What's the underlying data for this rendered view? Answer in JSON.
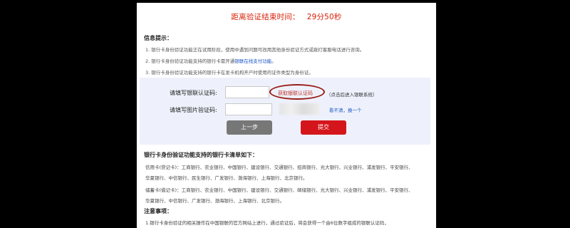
{
  "countdown": {
    "label": "距离验证结束时间：",
    "time": "29分50秒"
  },
  "info": {
    "title": "信息提示：",
    "lines": [
      "1. 银行卡身份验证功能正在试用阶段，使用中遇到问题可改用其他身份验证方式或拨打客服电话进行咨询。",
      "2. 银行卡身份验证功能支持的银行卡需开通",
      "3. 银行卡身份验证功能支持的银行卡在发卡机构开户时使用的证件类型为身份证。"
    ],
    "link": "银联在线支付功能",
    "line2_suffix": "。"
  },
  "form": {
    "sms_label": "请填写银联认证码:",
    "sms_link": "获取银联认证码",
    "sms_hint": "（点击后进入银联系统）",
    "captcha_label": "请填写图片验证码:",
    "refresh": "看不清，换一个",
    "prev_button": "上一步",
    "submit_button": "提交"
  },
  "banks": {
    "title": "银行卡身份验证功能支持的银行卡清单如下：",
    "credit_1": "信用卡(贷记卡)：工商银行、农业银行、中国银行、建设银行、交通银行、招商银行、光大银行、兴业银行、浦发银行、平安银行、",
    "credit_2": "华夏银行、中信银行、民生银行、广发银行、渤海银行、上海银行、北京银行。",
    "debit_1": "储蓄卡(借记卡)：工商银行、农业银行、中国银行、建设银行、交通银行、邮储银行、光大银行、兴业银行、浦发银行、平安银行、",
    "debit_2": "华夏银行、中信银行、广发银行、渤海银行、上海银行、北京银行。"
  },
  "notes": {
    "title": "注意事项：",
    "line1": "1.银行卡身份验证的相关操作在中国银联的官方网站上进行，通过验证后，将会获得一个由6位数字组成的银联认证码，"
  },
  "colors": {
    "countdown": "#d81e06",
    "submit": "#d4161c",
    "link": "#1a55c8",
    "verify_bg": "#eef1fb"
  }
}
